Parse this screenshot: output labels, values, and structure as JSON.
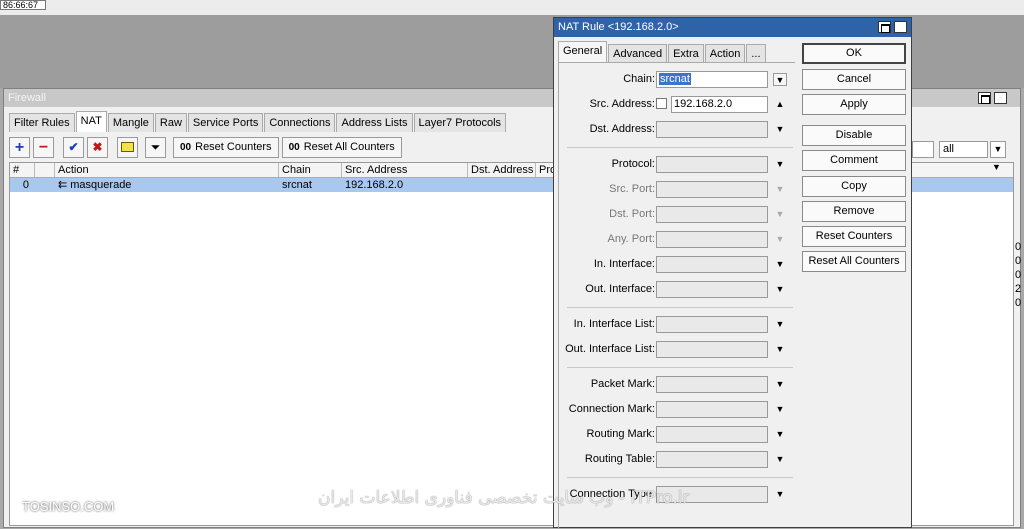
{
  "top_label": "86:66:67",
  "firewall": {
    "title": "Firewall",
    "tabs": [
      "Filter Rules",
      "NAT",
      "Mangle",
      "Raw",
      "Service Ports",
      "Connections",
      "Address Lists",
      "Layer7 Protocols"
    ],
    "active_tab": "NAT",
    "toolbar": {
      "reset_counters": "Reset Counters",
      "reset_all_counters": "Reset All Counters",
      "counter_icon_text": "00",
      "filter_value": "all"
    },
    "columns": [
      "#",
      "",
      "Action",
      "Chain",
      "Src. Address",
      "Dst. Address",
      "Prot"
    ],
    "rows": [
      {
        "num": "0",
        "action": "⇇ masquerade",
        "chain": "srcnat",
        "src": "192.168.2.0",
        "dst": ""
      }
    ],
    "edge_digits": [
      "0",
      "0",
      "0",
      "2",
      "0"
    ]
  },
  "dialog": {
    "title": "NAT Rule <192.168.2.0>",
    "tabs": [
      "General",
      "Advanced",
      "Extra",
      "Action",
      "..."
    ],
    "active_tab": "General",
    "fields": {
      "chain": {
        "label": "Chain:",
        "value": "srcnat"
      },
      "src_address": {
        "label": "Src. Address:",
        "value": "192.168.2.0"
      },
      "dst_address": {
        "label": "Dst. Address:",
        "value": ""
      },
      "protocol": {
        "label": "Protocol:",
        "value": ""
      },
      "src_port": {
        "label": "Src. Port:",
        "value": ""
      },
      "dst_port": {
        "label": "Dst. Port:",
        "value": ""
      },
      "any_port": {
        "label": "Any. Port:",
        "value": ""
      },
      "in_interface": {
        "label": "In. Interface:",
        "value": ""
      },
      "out_interface": {
        "label": "Out. Interface:",
        "value": ""
      },
      "in_interface_list": {
        "label": "In. Interface List:",
        "value": ""
      },
      "out_interface_list": {
        "label": "Out. Interface List:",
        "value": ""
      },
      "packet_mark": {
        "label": "Packet Mark:",
        "value": ""
      },
      "connection_mark": {
        "label": "Connection Mark:",
        "value": ""
      },
      "routing_mark": {
        "label": "Routing Mark:",
        "value": ""
      },
      "routing_table": {
        "label": "Routing Table:",
        "value": ""
      },
      "connection_type": {
        "label": "Connection Type:",
        "value": ""
      }
    },
    "buttons": {
      "ok": "OK",
      "cancel": "Cancel",
      "apply": "Apply",
      "disable": "Disable",
      "comment": "Comment",
      "copy": "Copy",
      "remove": "Remove",
      "reset_counters": "Reset Counters",
      "reset_all_counters": "Reset All Counters"
    }
  },
  "watermark": "وب سایت تخصصی فناوری اطلاعات ایران - ITPro.ir",
  "brand": "TOSINSO.COM",
  "colors": {
    "dialog_title": "#2e63a8",
    "selected_row": "#a8c8f0",
    "selection": "#3b74c9"
  }
}
